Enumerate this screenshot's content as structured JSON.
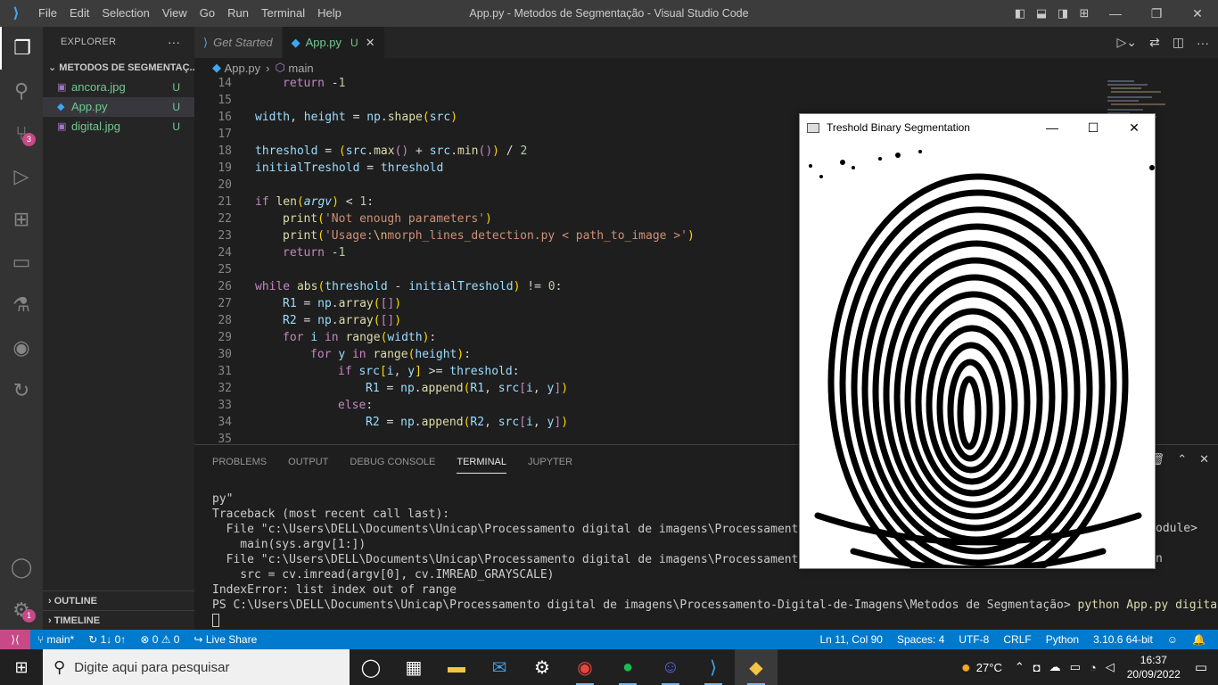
{
  "window": {
    "title": "App.py - Metodos de Segmentação - Visual Studio Code",
    "menu": [
      "File",
      "Edit",
      "Selection",
      "View",
      "Go",
      "Run",
      "Terminal",
      "Help"
    ]
  },
  "activity": {
    "source_control_badge": "3",
    "accounts_badge": "1"
  },
  "sidebar": {
    "title": "EXPLORER",
    "folder": "METODOS DE SEGMENTAÇ...",
    "files": [
      {
        "name": "ancora.jpg",
        "status": "U"
      },
      {
        "name": "App.py",
        "status": "U"
      },
      {
        "name": "digital.jpg",
        "status": "U"
      }
    ],
    "outline": "OUTLINE",
    "timeline": "TIMELINE"
  },
  "tabs": [
    {
      "label": "Get Started"
    },
    {
      "label": "App.py",
      "status": "U"
    }
  ],
  "breadcrumb": {
    "file": "App.py",
    "symbol": "main"
  },
  "code": {
    "line_numbers": [
      "14",
      "15",
      "16",
      "17",
      "18",
      "19",
      "20",
      "21",
      "22",
      "23",
      "24",
      "25",
      "26",
      "27",
      "28",
      "29",
      "30",
      "31",
      "32",
      "33",
      "34",
      "35"
    ]
  },
  "panel": {
    "tabs": [
      "PROBLEMS",
      "OUTPUT",
      "DEBUG CONSOLE",
      "TERMINAL",
      "JUPYTER"
    ],
    "active_tab": "TERMINAL",
    "terminal_lines": [
      "py\"",
      "Traceback (most recent call last):",
      "  File \"c:\\Users\\DELL\\Documents\\Unicap\\Processamento digital de imagens\\Processamento-Digital-",
      "    main(sys.argv[1:])",
      "  File \"c:\\Users\\DELL\\Documents\\Unicap\\Processamento digital de imagens\\Processamento-Digital-",
      "    src = cv.imread(argv[0], cv.IMREAD_GRAYSCALE)",
      "IndexError: list index out of range"
    ],
    "terminal_right_1": "odule>",
    "terminal_right_2": "n",
    "prompt": "PS C:\\Users\\DELL\\Documents\\Unicap\\Processamento digital de imagens\\Processamento-Digital-de-Imagens\\Metodos de Segmentação>",
    "command": "python App.py digital.jpg"
  },
  "image_window": {
    "title": "Treshold Binary Segmentation"
  },
  "status": {
    "branch": "main*",
    "sync": "1↓ 0↑",
    "problems": "⊗ 0 ⚠ 0",
    "live_share": "Live Share",
    "position": "Ln 11, Col 90",
    "spaces": "Spaces: 4",
    "encoding": "UTF-8",
    "eol": "CRLF",
    "language": "Python",
    "interpreter": "3.10.6 64-bit"
  },
  "taskbar": {
    "search_placeholder": "Digite aqui para pesquisar",
    "temperature": "27°C",
    "time": "16:37",
    "date": "20/09/2022"
  },
  "colors": {
    "accent": "#007acc",
    "untracked": "#73c991",
    "badge": "#c74a87"
  }
}
